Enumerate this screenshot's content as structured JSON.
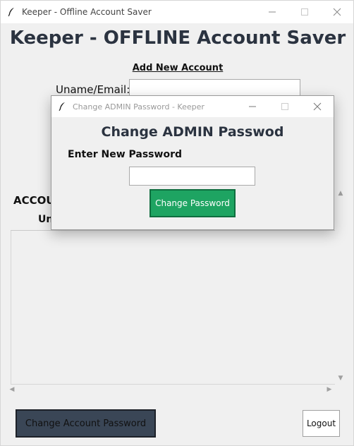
{
  "main_window": {
    "title": "Keeper - Offline Account Saver",
    "heading": "Keeper - OFFLINE Account Saver",
    "add_section_heading": "Add New Account",
    "uname_label": "Uname/Email:",
    "uname_value": "",
    "accounts_title_visible": "ACCOU",
    "table": {
      "columns_visible": [
        "Un"
      ],
      "rows": []
    },
    "buttons": {
      "change_account_password": "Change Account Password",
      "logout": "Logout"
    }
  },
  "dialog": {
    "title": "Change ADMIN Password - Keeper",
    "heading": "Change ADMIN Passwod",
    "label": "Enter New Password",
    "password_value": "",
    "submit_label": "Change Password"
  },
  "colors": {
    "window_bg": "#f0f0f0",
    "heading_text": "#2b3340",
    "dark_button": "#3a4656",
    "green_button": "#1ea462"
  },
  "icons": {
    "app": "feather-icon",
    "minimize": "minimize-icon",
    "maximize": "maximize-icon",
    "close": "close-icon"
  }
}
